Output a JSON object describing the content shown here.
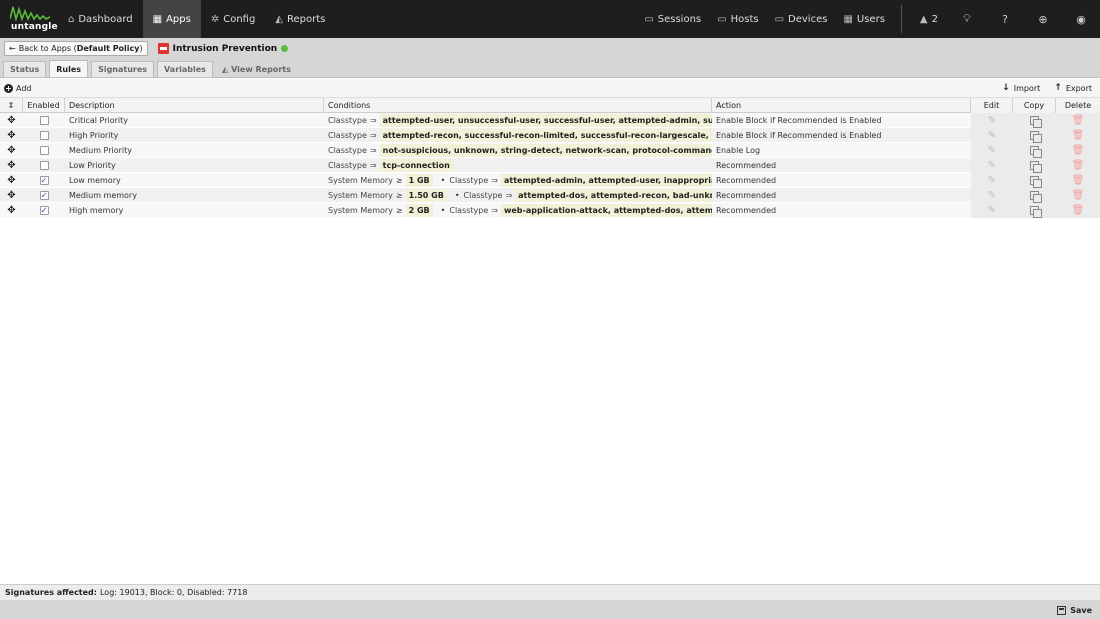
{
  "brand": {
    "name": "untangle",
    "accent": "#5cbb3a"
  },
  "nav": {
    "left": [
      {
        "label": "Dashboard",
        "icon": "home-icon"
      },
      {
        "label": "Apps",
        "icon": "grid-icon",
        "active": true
      },
      {
        "label": "Config",
        "icon": "gear-icon"
      },
      {
        "label": "Reports",
        "icon": "area-chart-icon"
      }
    ],
    "right": [
      {
        "label": "Sessions",
        "icon": "sessions-icon"
      },
      {
        "label": "Hosts",
        "icon": "hosts-icon"
      },
      {
        "label": "Devices",
        "icon": "devices-icon"
      },
      {
        "label": "Users",
        "icon": "users-icon"
      }
    ],
    "alert_count": "2"
  },
  "subheader": {
    "back_prefix": "Back to Apps (",
    "policy": "Default Policy",
    "back_suffix": ")",
    "app_title": "Intrusion Prevention",
    "status_color": "#5cbb3a"
  },
  "tabs": [
    "Status",
    "Rules",
    "Signatures",
    "Variables",
    "View Reports"
  ],
  "active_tab": "Rules",
  "toolbar": {
    "add": "Add",
    "import": "Import",
    "export": "Export"
  },
  "columns": {
    "enabled": "Enabled",
    "description": "Description",
    "conditions": "Conditions",
    "action": "Action",
    "edit": "Edit",
    "copy": "Copy",
    "delete": "Delete"
  },
  "rows": [
    {
      "enabled": false,
      "description": "Critical Priority",
      "conditions": [
        {
          "key": "Classtype",
          "op": "⇒",
          "value": "attempted-user, unsuccessful-user, successful-user, attempted-admin, successful..."
        }
      ],
      "action": "Enable Block if Recommended is Enabled"
    },
    {
      "enabled": false,
      "description": "High Priority",
      "conditions": [
        {
          "key": "Classtype",
          "op": "⇒",
          "value": "attempted-recon, successful-recon-limited, successful-recon-largescale, attempte..."
        }
      ],
      "action": "Enable Block if Recommended is Enabled"
    },
    {
      "enabled": false,
      "description": "Medium Priority",
      "conditions": [
        {
          "key": "Classtype",
          "op": "⇒",
          "value": "not-suspicious, unknown, string-detect, network-scan, protocol-command-decod..."
        }
      ],
      "action": "Enable Log"
    },
    {
      "enabled": false,
      "description": "Low Priority",
      "conditions": [
        {
          "key": "Classtype",
          "op": "⇒",
          "value": "tcp-connection"
        }
      ],
      "action": "Recommended"
    },
    {
      "enabled": true,
      "description": "Low memory",
      "conditions": [
        {
          "key": "System Memory",
          "op": "≥",
          "value": "1 GB"
        },
        {
          "key": "Classtype",
          "op": "⇒",
          "value": "attempted-admin, attempted-user, inappropriate-conte..."
        }
      ],
      "action": "Recommended"
    },
    {
      "enabled": true,
      "description": "Medium memory",
      "conditions": [
        {
          "key": "System Memory",
          "op": "≥",
          "value": "1.50 GB"
        },
        {
          "key": "Classtype",
          "op": "⇒",
          "value": "attempted-dos, attempted-recon, bad-unknown, def..."
        }
      ],
      "action": "Recommended"
    },
    {
      "enabled": true,
      "description": "High memory",
      "conditions": [
        {
          "key": "System Memory",
          "op": "≥",
          "value": "2 GB"
        },
        {
          "key": "Classtype",
          "op": "⇒",
          "value": "web-application-attack, attempted-dos, attempted-rec..."
        }
      ],
      "action": "Recommended"
    }
  ],
  "footer": {
    "label": "Signatures affected:",
    "text": "Log: 19013, Block: 0, Disabled: 7718",
    "save": "Save"
  }
}
